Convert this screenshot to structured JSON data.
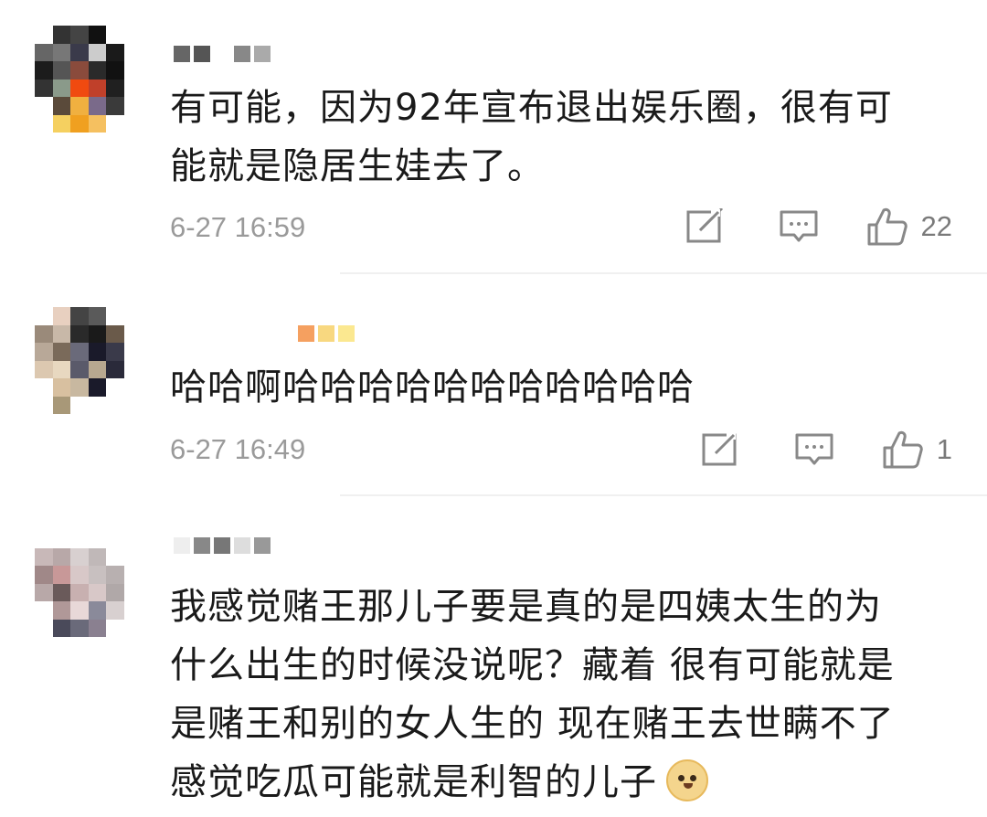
{
  "comments": [
    {
      "text_lines": [
        "有可能，因为92年宣布退出娱乐圈，很有可",
        "能就是隐居生娃去了。"
      ],
      "time": "6-27 16:59",
      "likes": "22",
      "avatar_colors": [
        "#ffffff",
        "#333333",
        "#444444",
        "#111111",
        "#ffffff",
        "#ffffff",
        "#666666",
        "#777777",
        "#3a3a4a",
        "#cccccc",
        "#1a1a1a",
        "#ffffff",
        "#1c1c1c",
        "#555555",
        "#8a4b3c",
        "#2a2a2a",
        "#111111",
        "#ffffff",
        "#333333",
        "#8a9a8a",
        "#f04a10",
        "#c0402a",
        "#202020",
        "#ffffff",
        "#ffffff",
        "#5a4a3a",
        "#f0b040",
        "#7a6a8a",
        "#3a3a3a",
        "#ffffff",
        "#ffffff",
        "#f5d060",
        "#f0a020",
        "#f5c060",
        "#ffffff",
        "#ffffff"
      ],
      "name_colors": [
        "#666666",
        "#555555",
        "#ffffff",
        "#888888",
        "#aaaaaa"
      ]
    },
    {
      "text_lines": [
        "哈哈啊哈哈哈哈哈哈哈哈哈哈哈"
      ],
      "time": "6-27 16:49",
      "likes": "1",
      "avatar_colors": [
        "#ffffff",
        "#e8d0c0",
        "#444444",
        "#5a5a5a",
        "#ffffff",
        "#ffffff",
        "#9a8a7a",
        "#c8b8a8",
        "#2a2a2a",
        "#1a1a1a",
        "#6a5a4a",
        "#ffffff",
        "#b8a898",
        "#7a6a5a",
        "#6a6a7a",
        "#1a1a2a",
        "#3a3a4a",
        "#ffffff",
        "#dcc8b0",
        "#e8d8c0",
        "#5a5a6a",
        "#b8a890",
        "#2a2a3a",
        "#ffffff",
        "#ffffff",
        "#d8c0a0",
        "#c8b8a0",
        "#1a1a2a",
        "#ffffff",
        "#ffffff",
        "#ffffff",
        "#a89878",
        "#ffffff",
        "#ffffff",
        "#ffffff",
        "#ffffff"
      ],
      "name_colors": [
        "#f5a060",
        "#f8d880",
        "#fbe890"
      ]
    },
    {
      "text_lines": [
        "我感觉赌王那儿子要是真的是四姨太生的为",
        "什么出生的时候没说呢？藏着 很有可能就是",
        "是赌王和别的女人生的 现在赌王去世瞒不了",
        "感觉吃瓜可能就是利智的儿子"
      ],
      "avatar_colors": [
        "#ffffff",
        "#ffffff",
        "#ffffff",
        "#ffffff",
        "#ffffff",
        "#ffffff",
        "#c8b8b8",
        "#b8a8a8",
        "#d8d0d0",
        "#c0b8b8",
        "#ffffff",
        "#ffffff",
        "#a08888",
        "#c89898",
        "#d8c8c8",
        "#c8c0c0",
        "#b8b0b0",
        "#ffffff",
        "#b8a8a8",
        "#6a5a5a",
        "#c8b0b0",
        "#d8c8c8",
        "#b0a8a8",
        "#ffffff",
        "#ffffff",
        "#b09898",
        "#e8d8d8",
        "#8a8a9a",
        "#d8d0d0",
        "#ffffff",
        "#ffffff",
        "#4a4a5a",
        "#6a6a7a",
        "#8a8090",
        "#ffffff",
        "#ffffff"
      ],
      "name_colors": [
        "#eeeeee",
        "#888888",
        "#777777",
        "#dddddd",
        "#999999"
      ]
    }
  ]
}
